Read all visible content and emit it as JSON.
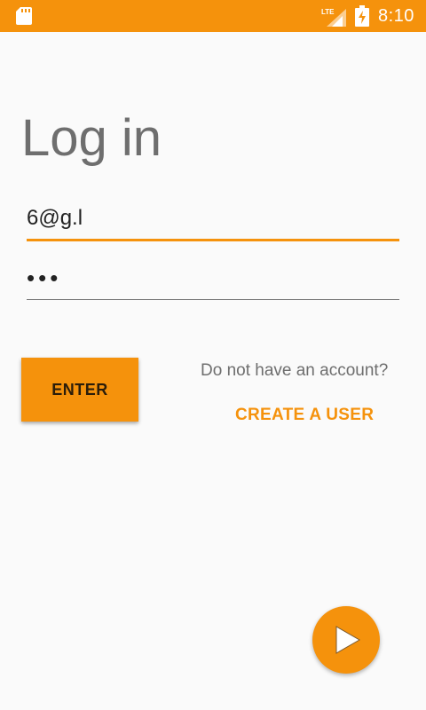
{
  "status_bar": {
    "time": "8:10",
    "network_label": "LTE",
    "icons": [
      "sd-card-icon",
      "lte-signal-icon",
      "battery-icon"
    ]
  },
  "login": {
    "title": "Log in",
    "email_value": "6@g.l",
    "password_value": "•••",
    "enter_label": "ENTER",
    "no_account_text": "Do not have an account?",
    "create_user_label": "CREATE A USER"
  },
  "fab": {
    "icon": "play-icon"
  },
  "colors": {
    "accent": "#f5920c",
    "background": "#fafafa",
    "title_text": "#6e6e6e",
    "input_text": "#222222"
  }
}
